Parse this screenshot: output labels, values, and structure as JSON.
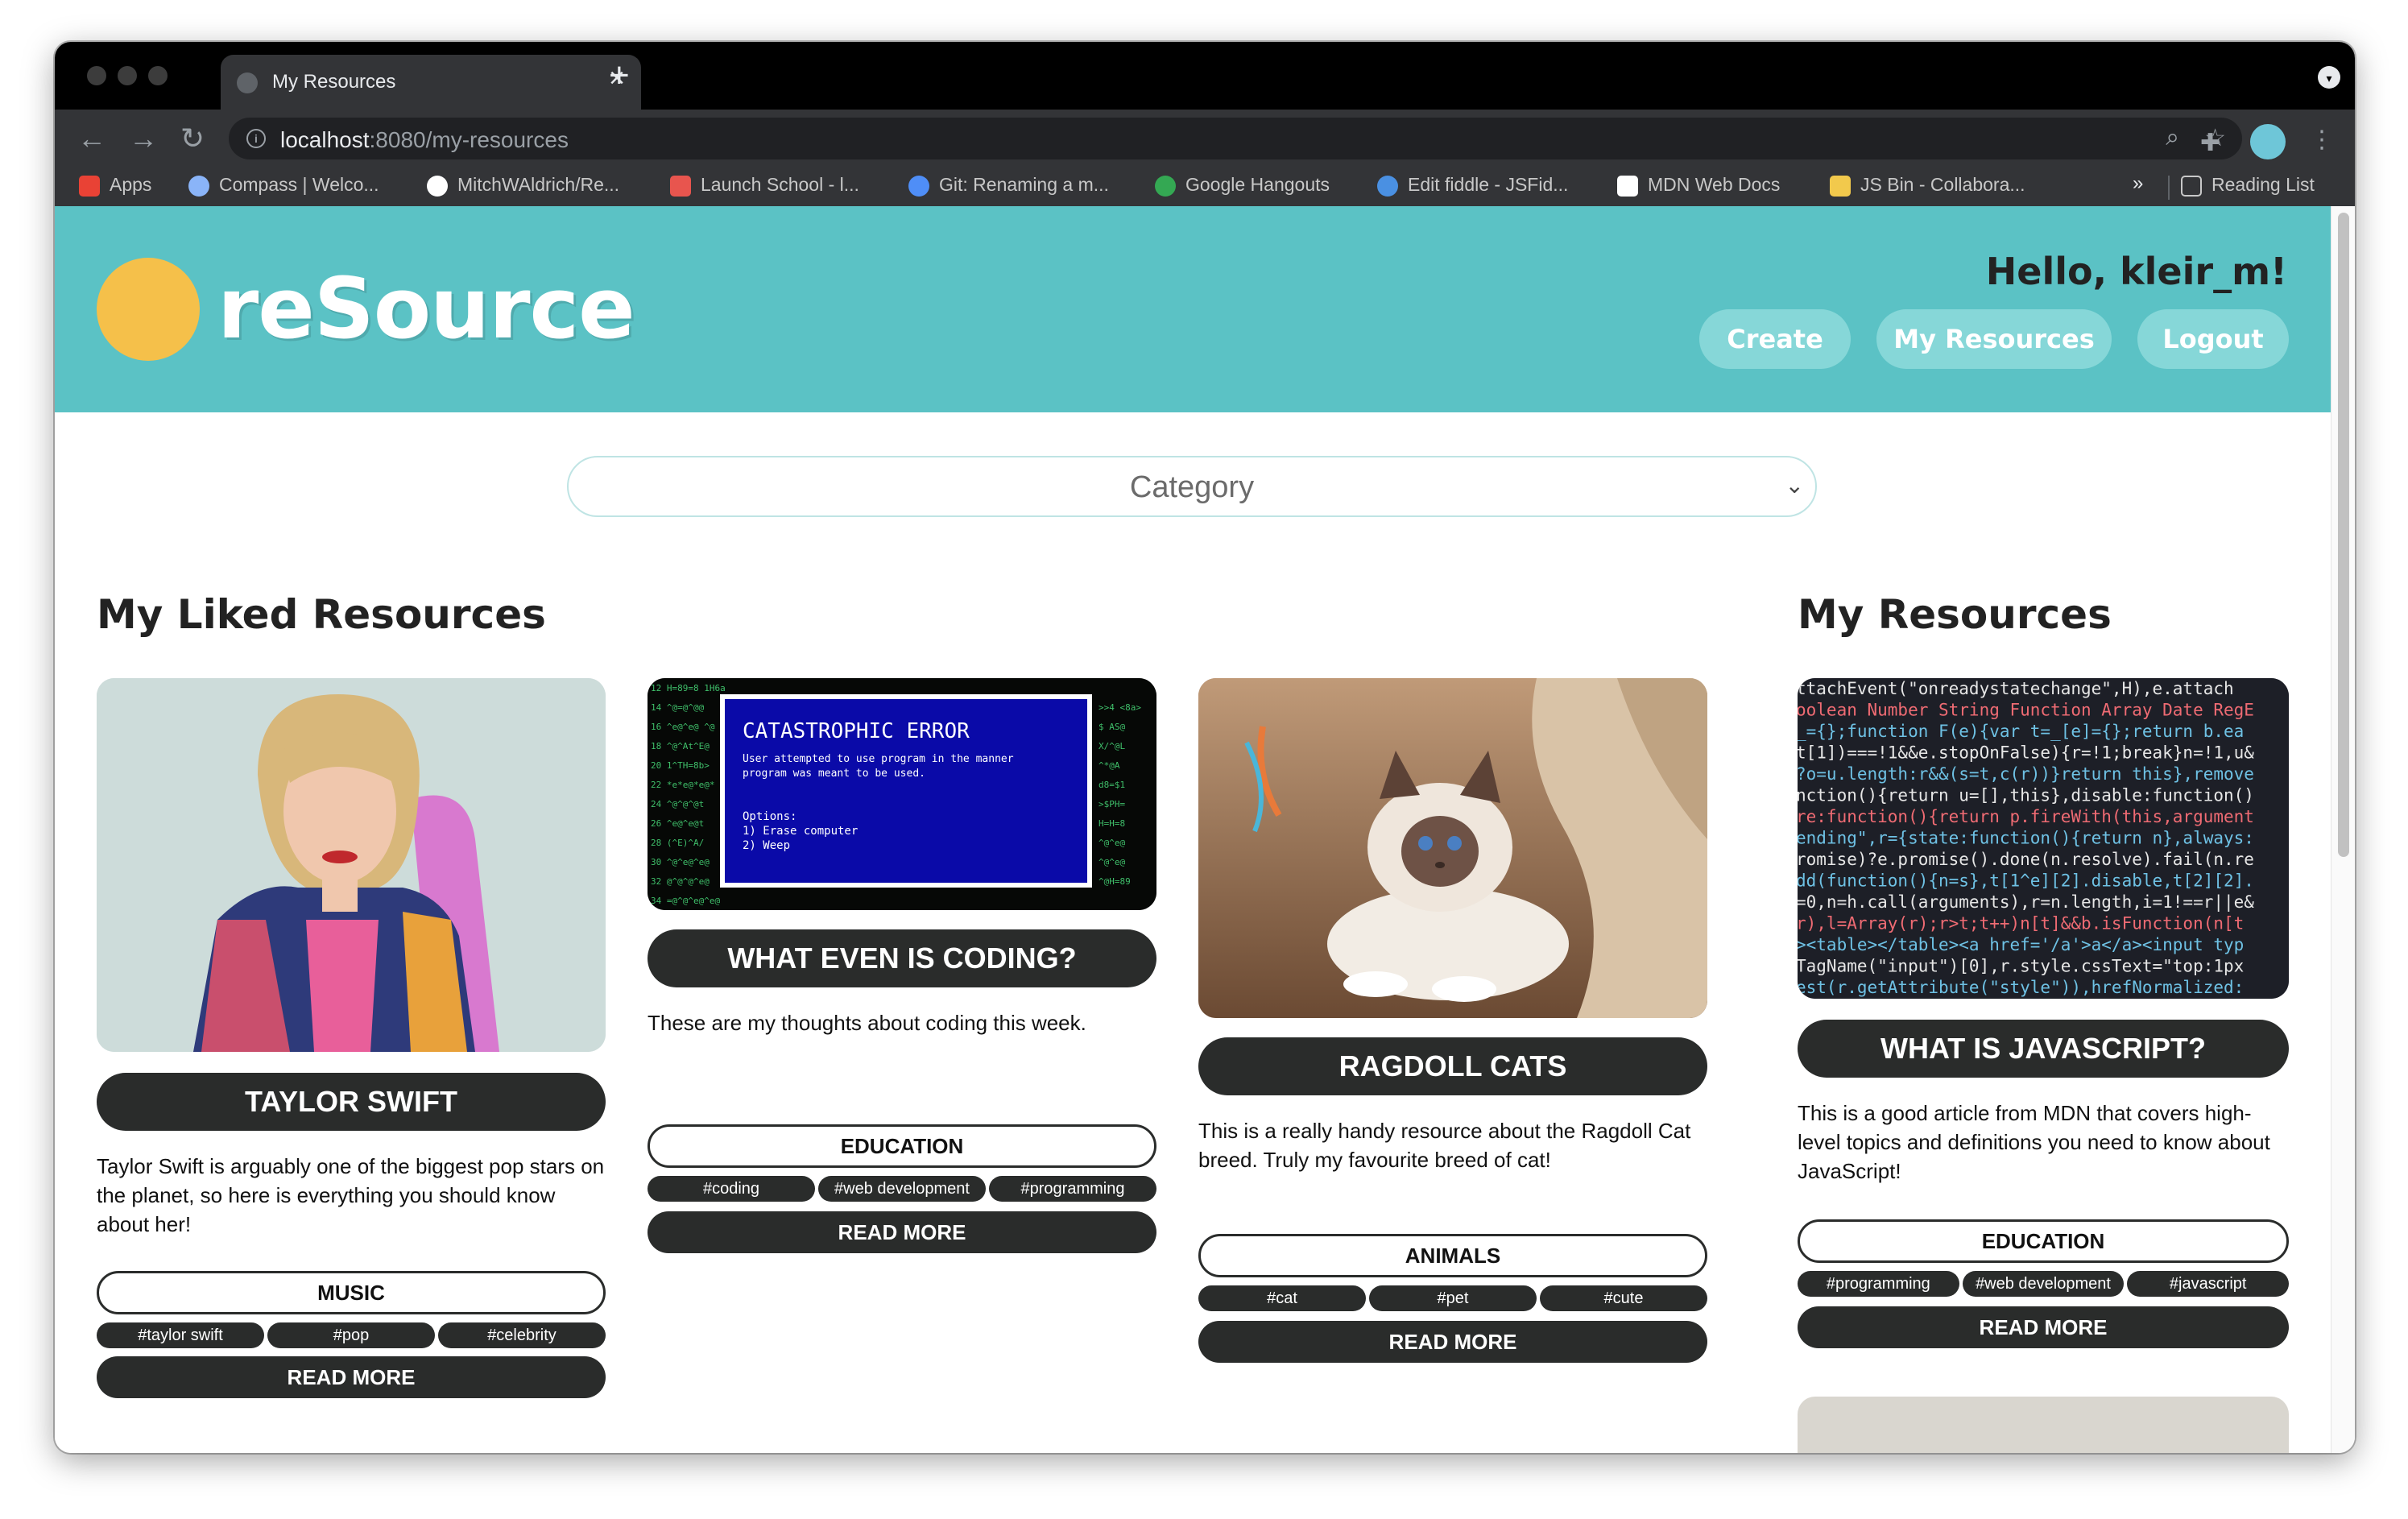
{
  "browser": {
    "tab_title": "My Resources",
    "url_host": "localhost",
    "url_path": ":8080/my-resources",
    "bookmarks": [
      {
        "label": "Apps",
        "color": "#e94235"
      },
      {
        "label": "Compass | Welco...",
        "color": "#8ab4f8"
      },
      {
        "label": "MitchWAldrich/Re...",
        "color": "#ffffff"
      },
      {
        "label": "Launch School - l...",
        "color": "#e8554e"
      },
      {
        "label": "Git: Renaming a m...",
        "color": "#4f8ef7"
      },
      {
        "label": "Google Hangouts",
        "color": "#34a853"
      },
      {
        "label": "Edit fiddle - JSFid...",
        "color": "#4a90e2"
      },
      {
        "label": "MDN Web Docs",
        "color": "#ffffff"
      },
      {
        "label": "JS Bin - Collabora...",
        "color": "#f2c94c"
      }
    ],
    "more_bookmarks": "»",
    "reading_list": "Reading List"
  },
  "header": {
    "logo_text": "reSource",
    "greeting": "Hello, kleir_m!",
    "nav": [
      "Create",
      "My Resources",
      "Logout"
    ]
  },
  "filter": {
    "category_placeholder": "Category"
  },
  "sections": {
    "liked_title": "My Liked Resources",
    "mine_title": "My Resources"
  },
  "liked_resources": [
    {
      "title": "TAYLOR SWIFT",
      "description": "Taylor Swift is arguably one of the biggest pop stars on the planet, so here is everything you should know about her!",
      "category": "MUSIC",
      "tags": [
        "#taylor swift",
        "#pop",
        "#celebrity"
      ],
      "read_more": "READ MORE"
    },
    {
      "title": "WHAT EVEN IS CODING?",
      "description": "These are my thoughts about coding this week.",
      "category": "EDUCATION",
      "tags": [
        "#coding",
        "#web development",
        "#programming"
      ],
      "read_more": "READ MORE",
      "image_text": {
        "heading": "CATASTROPHIC ERROR",
        "line1": "User attempted to use program in the manner",
        "line2": "program was meant to be used.",
        "options": "Options:",
        "opt1": "1) Erase computer",
        "opt2": "2) Weep"
      }
    },
    {
      "title": "RAGDOLL CATS",
      "description": "This is a really handy resource about the Ragdoll Cat breed. Truly my favourite breed of cat!",
      "category": "ANIMALS",
      "tags": [
        "#cat",
        "#pet",
        "#cute"
      ],
      "read_more": "READ MORE"
    }
  ],
  "my_resources": [
    {
      "title": "WHAT IS JAVASCRIPT?",
      "description": "This is a good article from MDN that covers high-level topics and definitions you need to know about JavaScript!",
      "category": "EDUCATION",
      "tags": [
        "#programming",
        "#web development",
        "#javascript"
      ],
      "read_more": "READ MORE",
      "code_lines": [
        "ttachEvent(\"onreadystatechange\",H),e.attach",
        "oolean Number String Function Array Date RegE",
        "_={};function F(e){var t=_[e]={};return b.ea",
        "t[1])===!1&&e.stopOnFalse){r=!1;break}n=!1,u&",
        "?o=u.length:r&&(s=t,c(r))}return this},remove",
        "nction(){return u=[],this},disable:function()",
        "re:function(){return p.fireWith(this,argument",
        "ending\",r={state:function(){return n},always:",
        "romise)?e.promise().done(n.resolve).fail(n.re",
        "dd(function(){n=s},t[1^e][2].disable,t[2][2].",
        "=0,n=h.call(arguments),r=n.length,i=1!==r||e&",
        "r),l=Array(r);r>t;t++)n[t]&&b.isFunction(n[t",
        "><table></table><a href='/a'>a</a><input typ",
        "TagName(\"input\")[0],r.style.cssText=\"top:1px",
        "est(r.getAttribute(\"style\")),hrefNormalized:"
      ]
    }
  ]
}
